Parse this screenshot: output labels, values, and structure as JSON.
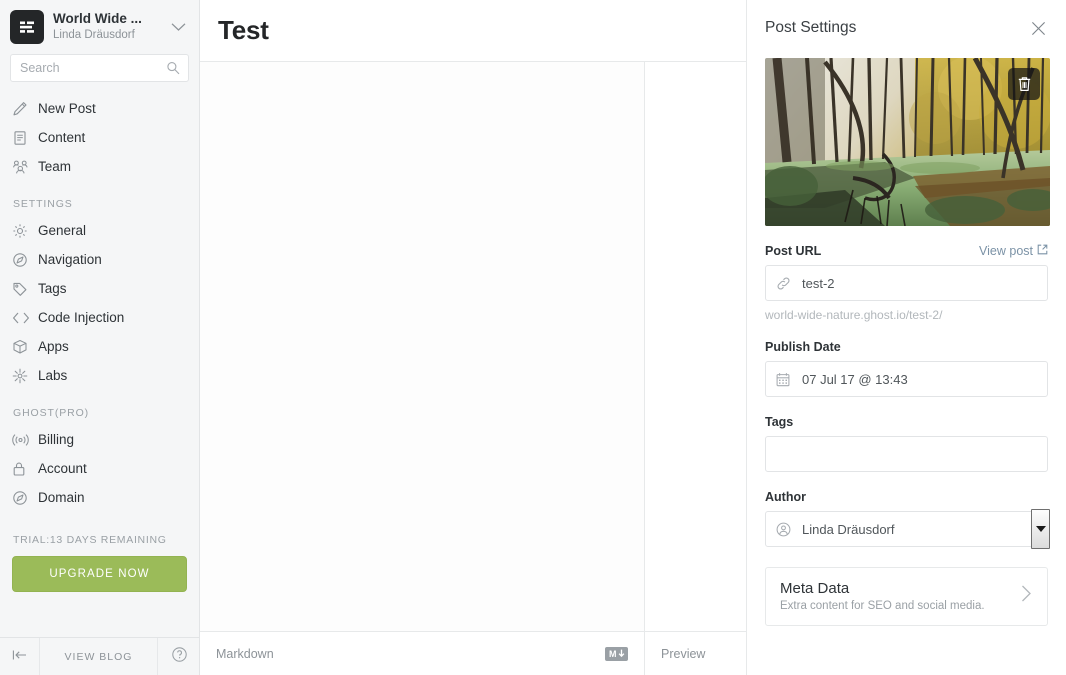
{
  "sidebar": {
    "blog": {
      "title": "World Wide ...",
      "user": "Linda Dräusdorf"
    },
    "search": {
      "placeholder": "Search",
      "value": ""
    },
    "primary_nav": [
      {
        "label": "New Post",
        "icon": "pencil-icon"
      },
      {
        "label": "Content",
        "icon": "document-icon"
      },
      {
        "label": "Team",
        "icon": "team-icon"
      }
    ],
    "settings_heading": "SETTINGS",
    "settings_nav": [
      {
        "label": "General",
        "icon": "gear-icon"
      },
      {
        "label": "Navigation",
        "icon": "compass-icon"
      },
      {
        "label": "Tags",
        "icon": "tag-icon"
      },
      {
        "label": "Code Injection",
        "icon": "code-icon"
      },
      {
        "label": "Apps",
        "icon": "box-icon"
      },
      {
        "label": "Labs",
        "icon": "labs-icon"
      }
    ],
    "pro_heading": "GHOST(PRO)",
    "pro_nav": [
      {
        "label": "Billing",
        "icon": "broadcast-icon"
      },
      {
        "label": "Account",
        "icon": "lock-icon"
      },
      {
        "label": "Domain",
        "icon": "compass-icon"
      }
    ],
    "trial_text": "TRIAL:13 DAYS REMAINING",
    "upgrade_label": "UPGRADE NOW",
    "footer": {
      "view_blog_label": "VIEW BLOG"
    }
  },
  "editor": {
    "title": "Test",
    "markdown_label": "Markdown",
    "markdown_badge": "M",
    "preview_label": "Preview",
    "content": ""
  },
  "panel": {
    "title": "Post Settings",
    "cover_image": {
      "alt": "autumn forest swamp with green algae pond"
    },
    "post_url": {
      "label": "Post URL",
      "view_post_label": "View post",
      "value": "test-2",
      "hint": "world-wide-nature.ghost.io/test-2/"
    },
    "publish_date": {
      "label": "Publish Date",
      "value": "07 Jul 17 @ 13:43"
    },
    "tags": {
      "label": "Tags",
      "value": ""
    },
    "author": {
      "label": "Author",
      "value": "Linda Dräusdorf",
      "options": [
        "Linda Dräusdorf"
      ]
    },
    "meta_data": {
      "title": "Meta Data",
      "subtitle": "Extra content for SEO and social media."
    }
  },
  "colors": {
    "accent_green": "#9bbb59",
    "sidebar_bg": "#f5f6f7",
    "link_blue": "#7b92a6",
    "text_dark": "#2e3337"
  }
}
